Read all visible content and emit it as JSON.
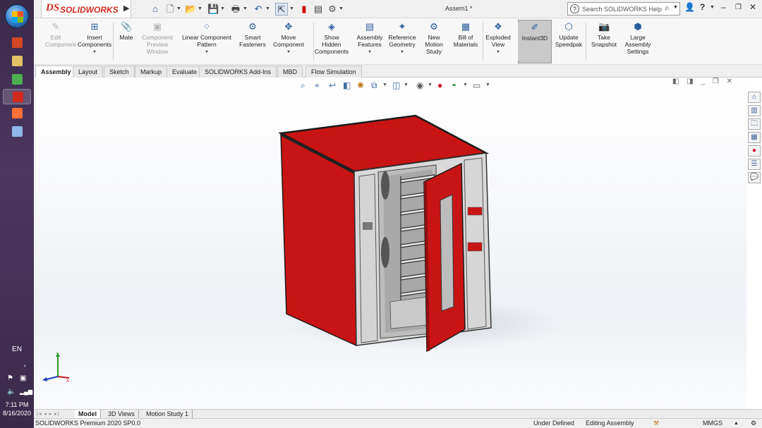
{
  "window": {
    "title": "Assem1 *"
  },
  "app": {
    "logo_text": "SOLIDWORKS",
    "logo_ds": "DS"
  },
  "search": {
    "placeholder": "Search SOLIDWORKS Help"
  },
  "taskbar": {
    "language": "EN",
    "time": "7:11 PM",
    "date": "8/16/2020",
    "apps": [
      {
        "icon": "powerpoint-icon",
        "color": "#d24726"
      },
      {
        "icon": "file-explorer-icon",
        "color": "#e3c169"
      },
      {
        "icon": "chrome-icon",
        "color": "#4caf50"
      },
      {
        "icon": "solidworks-icon",
        "color": "#d22a1e"
      },
      {
        "icon": "firefox-icon",
        "color": "#ff7139"
      },
      {
        "icon": "document-icon",
        "color": "#8fb8e8"
      }
    ]
  },
  "command_manager": {
    "buttons": [
      {
        "name": "edit-component-button",
        "label1": "Edit",
        "label2": "Component",
        "icon": "✎",
        "disabled": true,
        "dropdown": false
      },
      {
        "name": "insert-components-button",
        "label1": "Insert",
        "label2": "Components",
        "icon": "⊞",
        "disabled": false,
        "dropdown": true
      },
      {
        "name": "mate-button",
        "label1": "Mate",
        "label2": "",
        "icon": "📎",
        "disabled": false,
        "dropdown": false
      },
      {
        "name": "component-preview-window-button",
        "label1": "Component",
        "label2": "Preview",
        "label3": "Window",
        "icon": "▣",
        "disabled": true,
        "dropdown": false
      },
      {
        "name": "linear-component-pattern-button",
        "label1": "Linear Component",
        "label2": "Pattern",
        "icon": "⁘",
        "disabled": false,
        "dropdown": true
      },
      {
        "name": "smart-fasteners-button",
        "label1": "Smart",
        "label2": "Fasteners",
        "icon": "⚙",
        "disabled": false,
        "dropdown": false
      },
      {
        "name": "move-component-button",
        "label1": "Move",
        "label2": "Component",
        "icon": "✥",
        "disabled": false,
        "dropdown": true
      },
      {
        "name": "show-hidden-components-button",
        "label1": "Show",
        "label2": "Hidden",
        "label3": "Components",
        "icon": "◈",
        "disabled": false,
        "dropdown": false
      },
      {
        "name": "assembly-features-button",
        "label1": "Assembly",
        "label2": "Features",
        "icon": "▤",
        "disabled": false,
        "dropdown": true
      },
      {
        "name": "reference-geometry-button",
        "label1": "Reference",
        "label2": "Geometry",
        "icon": "✦",
        "disabled": false,
        "dropdown": true
      },
      {
        "name": "new-motion-study-button",
        "label1": "New",
        "label2": "Motion",
        "label3": "Study",
        "icon": "⚙",
        "disabled": false,
        "dropdown": false
      },
      {
        "name": "bill-of-materials-button",
        "label1": "Bill of",
        "label2": "Materials",
        "icon": "▦",
        "disabled": false,
        "dropdown": false
      },
      {
        "name": "exploded-view-button",
        "label1": "Exploded",
        "label2": "View",
        "icon": "❖",
        "disabled": false,
        "dropdown": true
      },
      {
        "name": "instant3d-button",
        "label1": "Instant3D",
        "label2": "",
        "icon": "✐",
        "disabled": false,
        "dropdown": false,
        "pressed": true
      },
      {
        "name": "update-speedpak-button",
        "label1": "Update",
        "label2": "Speedpak",
        "icon": "⬡",
        "disabled": false,
        "dropdown": false
      },
      {
        "name": "take-snapshot-button",
        "label1": "Take",
        "label2": "Snapshot",
        "icon": "📷",
        "disabled": false,
        "dropdown": false
      },
      {
        "name": "large-assembly-settings-button",
        "label1": "Large",
        "label2": "Assembly",
        "label3": "Settings",
        "icon": "⬢",
        "disabled": false,
        "dropdown": false
      }
    ]
  },
  "tabs": [
    "Assembly",
    "Layout",
    "Sketch",
    "Markup",
    "Evaluate",
    "SOLIDWORKS Add-Ins",
    "MBD",
    "Flow Simulation"
  ],
  "active_tab": "Assembly",
  "bottom_tabs": [
    "Model",
    "3D Views",
    "Motion Study 1"
  ],
  "active_bottom_tab": "Model",
  "status": {
    "product": "SOLIDWORKS Premium 2020 SP0.0",
    "state": "Under Defined",
    "mode": "Editing Assembly",
    "units": "MMGS"
  },
  "colors": {
    "cabinet_red": "#c81414",
    "cabinet_gray": "#d4d4d4",
    "accent_blue": "#2d5f9e"
  }
}
